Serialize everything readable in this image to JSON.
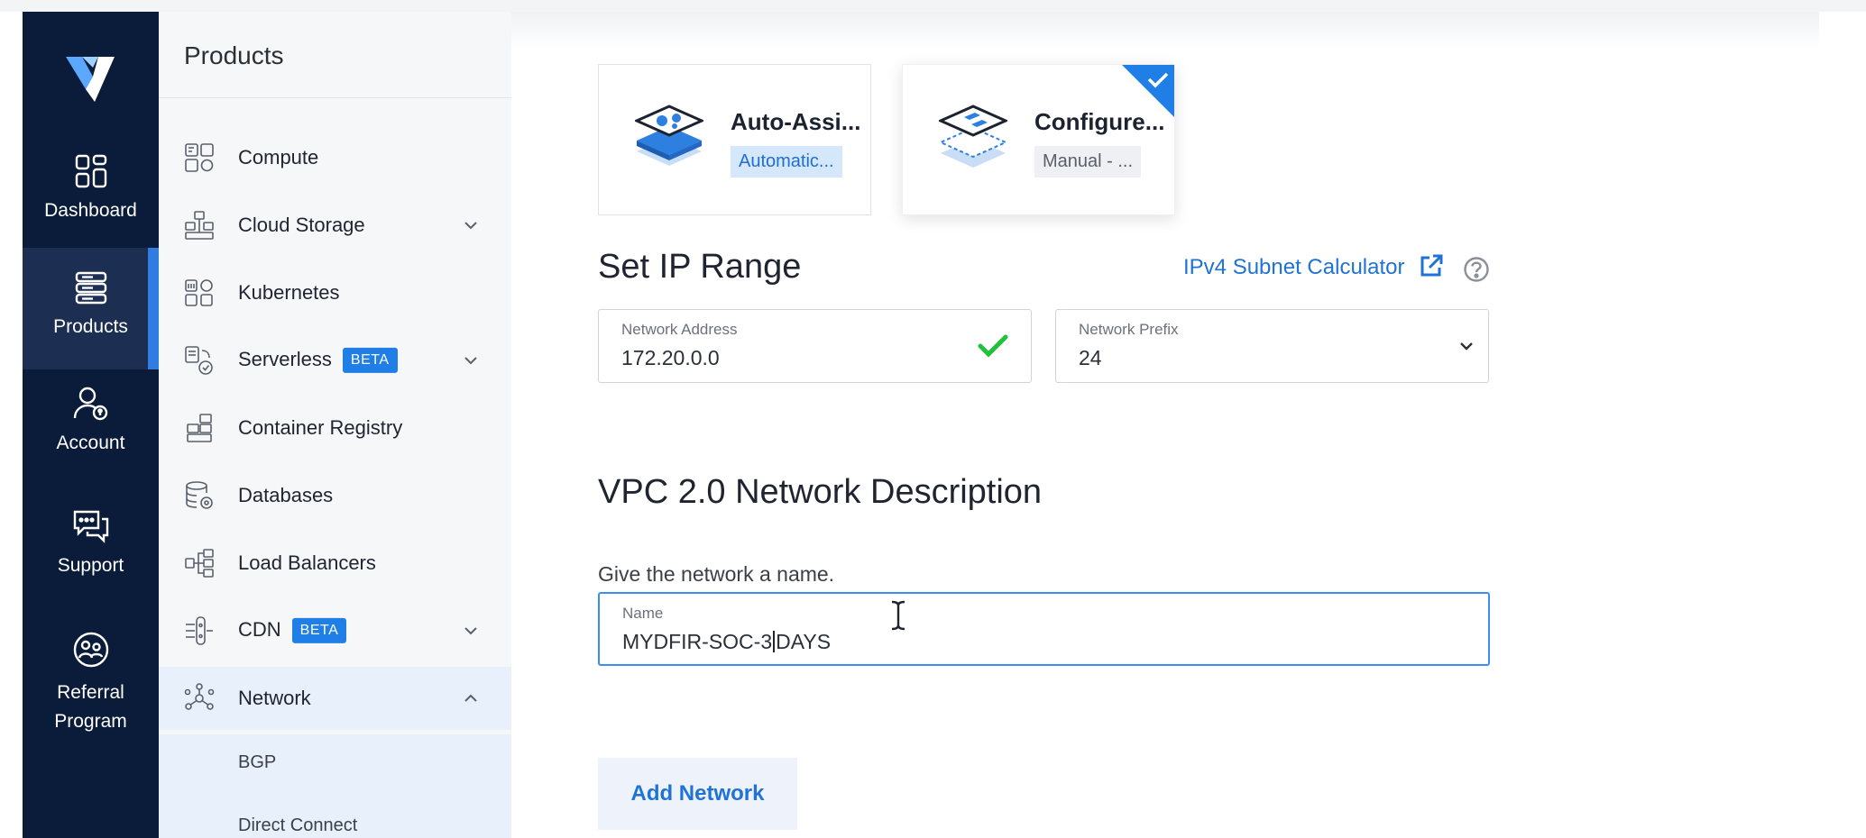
{
  "rail": {
    "items": [
      {
        "label": "Dashboard",
        "icon": "dashboard-icon"
      },
      {
        "label": "Products",
        "icon": "products-icon",
        "active": true
      },
      {
        "label": "Account",
        "icon": "account-icon"
      },
      {
        "label": "Support",
        "icon": "support-icon"
      },
      {
        "label": "Referral Program",
        "icon": "referral-icon"
      }
    ]
  },
  "panel": {
    "title": "Products",
    "items": [
      {
        "label": "Compute",
        "icon": "compute-icon"
      },
      {
        "label": "Cloud Storage",
        "icon": "cloud-storage-icon",
        "chevron": "down"
      },
      {
        "label": "Kubernetes",
        "icon": "kubernetes-icon"
      },
      {
        "label": "Serverless",
        "icon": "serverless-icon",
        "badge": "BETA",
        "chevron": "down"
      },
      {
        "label": "Container Registry",
        "icon": "container-registry-icon"
      },
      {
        "label": "Databases",
        "icon": "databases-icon"
      },
      {
        "label": "Load Balancers",
        "icon": "load-balancers-icon"
      },
      {
        "label": "CDN",
        "icon": "cdn-icon",
        "badge": "BETA",
        "chevron": "down"
      },
      {
        "label": "Network",
        "icon": "network-icon",
        "chevron": "up",
        "expanded": true
      }
    ],
    "subitems": [
      {
        "label": "BGP"
      },
      {
        "label": "Direct Connect"
      }
    ]
  },
  "cards": [
    {
      "title": "Auto-Assi...",
      "tag": "Automatic...",
      "selected": false
    },
    {
      "title": "Configure...",
      "tag": "Manual - ...",
      "selected": true
    }
  ],
  "ip_range": {
    "heading": "Set IP Range",
    "calculator_link": "IPv4 Subnet Calculator",
    "network_address": {
      "label": "Network Address",
      "value": "172.20.0.0",
      "valid": true
    },
    "network_prefix": {
      "label": "Network Prefix",
      "value": "24"
    }
  },
  "description": {
    "heading": "VPC 2.0 Network Description",
    "instruction": "Give the network a name.",
    "name_field": {
      "label": "Name",
      "value_before_caret": "MYDFIR-SOC-3",
      "value_after_caret": "DAYS"
    }
  },
  "actions": {
    "add_network": "Add Network"
  },
  "colors": {
    "rail_bg": "#0b1c3a",
    "accent": "#1f73d6",
    "beta_badge": "#1f7fe6",
    "valid_check": "#1fc23a"
  }
}
